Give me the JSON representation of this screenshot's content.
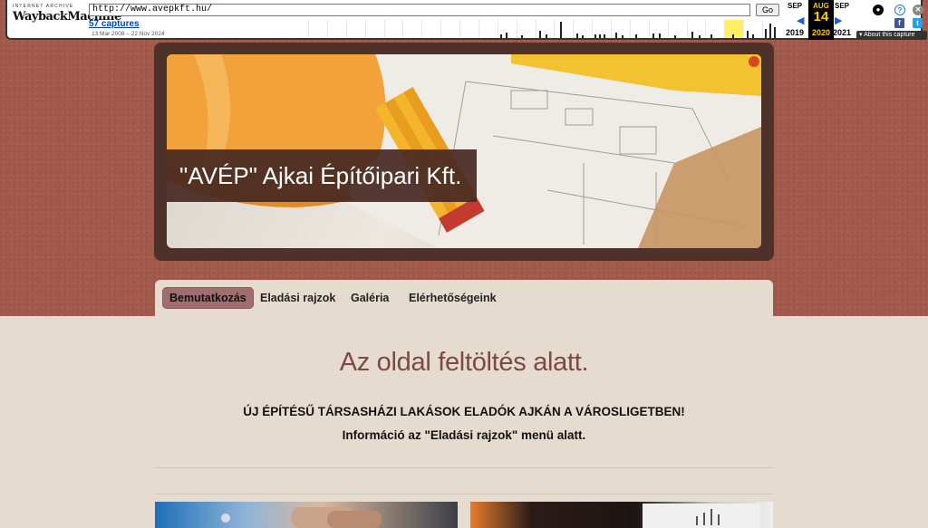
{
  "wayback": {
    "logo_top": "INTERNET ARCHIVE",
    "logo_main_1": "Wayback",
    "logo_main_2": "Machine",
    "url": "http://www.avepkft.hu/",
    "go_label": "Go",
    "captures": "57 captures",
    "date_range": "13 Mar 2008 – 22 Nov 2024",
    "prev_month": "SEP",
    "cur_month": "AUG",
    "next_month": "SEP",
    "cur_day": "14",
    "prev_year": "2019",
    "cur_year": "2020",
    "next_year": "2021",
    "about_label": "About this capture"
  },
  "site": {
    "title": "\"AVÉP\" Ajkai Építőipari Kft.",
    "nav": [
      {
        "label": "Bemutatkozás",
        "active": true
      },
      {
        "label": "Eladási rajzok",
        "active": false
      },
      {
        "label": "Galéria",
        "active": false
      },
      {
        "label": "Elérhetőségeink",
        "active": false
      }
    ],
    "headline": "Az oldal feltöltés alatt.",
    "line1": "ÚJ ÉPÍTÉSŰ TÁRSASHÁZI LAKÁSOK ELADÓK AJKÁN A VÁROSLIGETBEN!",
    "line2": "Információ az \"Eladási rajzok\" menü alatt."
  }
}
